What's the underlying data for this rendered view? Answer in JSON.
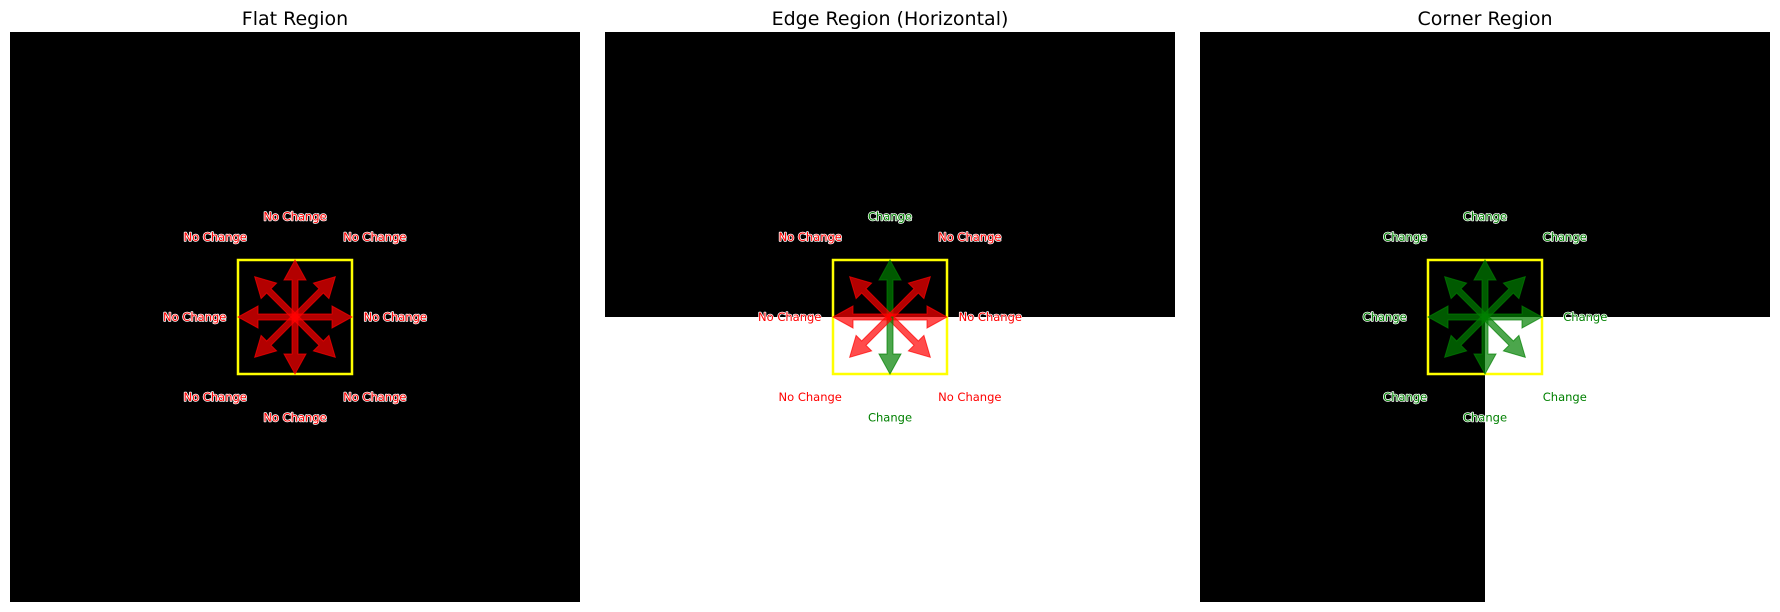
{
  "colors": {
    "dark": "#000000",
    "light": "#ffffff",
    "window": "#ffff00",
    "no_change": "#ff0000",
    "change": "#008000"
  },
  "panels": [
    {
      "id": "flat",
      "title": "Flat Region",
      "pattern": "all-dark",
      "directions": [
        {
          "dir": "N",
          "label": "No Change",
          "status": "no_change"
        },
        {
          "dir": "NE",
          "label": "No Change",
          "status": "no_change"
        },
        {
          "dir": "E",
          "label": "No Change",
          "status": "no_change"
        },
        {
          "dir": "SE",
          "label": "No Change",
          "status": "no_change"
        },
        {
          "dir": "S",
          "label": "No Change",
          "status": "no_change"
        },
        {
          "dir": "SW",
          "label": "No Change",
          "status": "no_change"
        },
        {
          "dir": "W",
          "label": "No Change",
          "status": "no_change"
        },
        {
          "dir": "NW",
          "label": "No Change",
          "status": "no_change"
        }
      ]
    },
    {
      "id": "edge",
      "title": "Edge Region (Horizontal)",
      "pattern": "top-dark-bottom-light",
      "directions": [
        {
          "dir": "N",
          "label": "Change",
          "status": "change"
        },
        {
          "dir": "NE",
          "label": "No Change",
          "status": "no_change"
        },
        {
          "dir": "E",
          "label": "No Change",
          "status": "no_change"
        },
        {
          "dir": "SE",
          "label": "No Change",
          "status": "no_change"
        },
        {
          "dir": "S",
          "label": "Change",
          "status": "change"
        },
        {
          "dir": "SW",
          "label": "No Change",
          "status": "no_change"
        },
        {
          "dir": "W",
          "label": "No Change",
          "status": "no_change"
        },
        {
          "dir": "NW",
          "label": "No Change",
          "status": "no_change"
        }
      ]
    },
    {
      "id": "corner",
      "title": "Corner Region",
      "pattern": "bottom-right-light",
      "directions": [
        {
          "dir": "N",
          "label": "Change",
          "status": "change"
        },
        {
          "dir": "NE",
          "label": "Change",
          "status": "change"
        },
        {
          "dir": "E",
          "label": "Change",
          "status": "change"
        },
        {
          "dir": "SE",
          "label": "Change",
          "status": "change"
        },
        {
          "dir": "S",
          "label": "Change",
          "status": "change"
        },
        {
          "dir": "SW",
          "label": "Change",
          "status": "change"
        },
        {
          "dir": "W",
          "label": "Change",
          "status": "change"
        },
        {
          "dir": "NW",
          "label": "Change",
          "status": "change"
        }
      ]
    }
  ]
}
